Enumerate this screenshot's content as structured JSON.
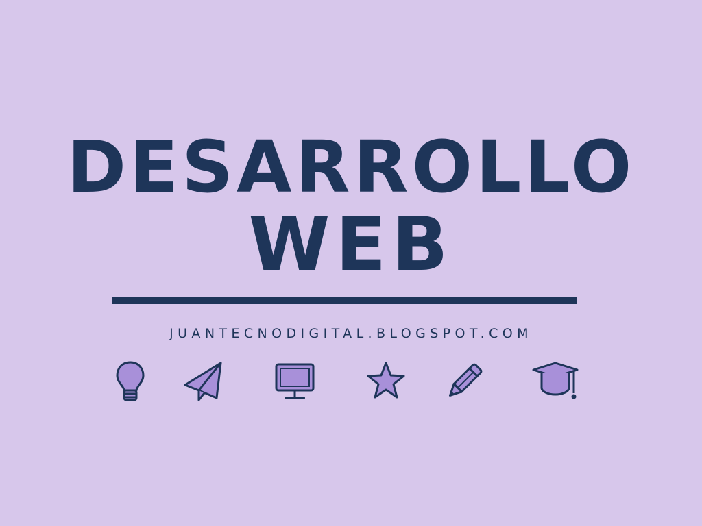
{
  "colors": {
    "background": "#d7c7eb",
    "primary": "#1e3559",
    "icon_fill": "#a890d9"
  },
  "title": {
    "line1": "DESARROLLO",
    "line2": "WEB"
  },
  "subtitle": "JUANTECNODIGITAL.BLOGSPOT.COM",
  "icons": [
    "lightbulb-icon",
    "paper-plane-icon",
    "monitor-icon",
    "star-icon",
    "pencil-icon",
    "graduation-cap-icon"
  ]
}
